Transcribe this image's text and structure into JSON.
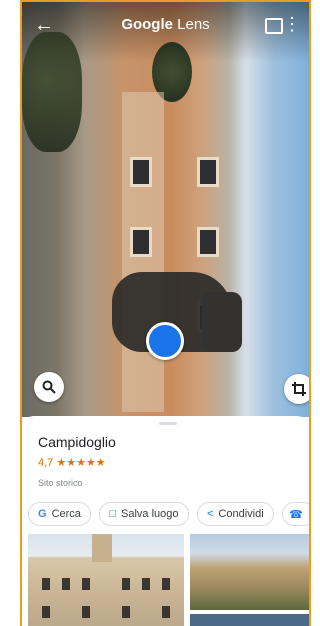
{
  "header": {
    "title_brand": "Google",
    "title_product": " Lens"
  },
  "place": {
    "name": "Campidoglio",
    "rating": "4,7",
    "stars": "★★★★★",
    "category": "Sito storico"
  },
  "chips": [
    {
      "label": "Cerca",
      "icon": "google-g-icon"
    },
    {
      "label": "Salva luogo",
      "icon": "bookmark-icon"
    },
    {
      "label": "Condividi",
      "icon": "share-icon"
    }
  ],
  "colors": {
    "accent": "#1a73e8",
    "rating": "#e37400",
    "frame": "#f19a1c"
  }
}
